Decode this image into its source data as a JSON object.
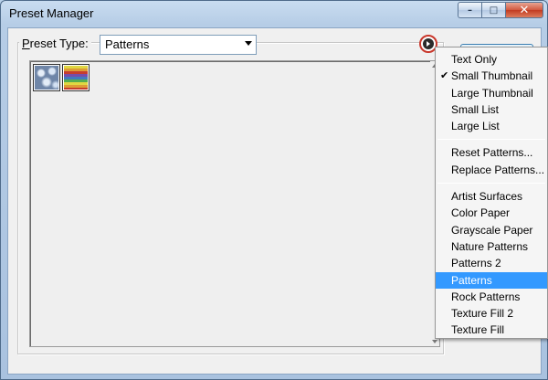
{
  "window": {
    "title": "Preset Manager",
    "controls": {
      "minimize": "–",
      "maximize": "□",
      "close": "✕"
    }
  },
  "preset_type": {
    "label_access": "P",
    "label_rest": "reset Type:",
    "value": "Patterns"
  },
  "thumbnails": [
    {
      "name": "bubbles-pattern"
    },
    {
      "name": "rainbow-pattern"
    }
  ],
  "menu": {
    "view_items": [
      {
        "label": "Text Only",
        "checked": false
      },
      {
        "label": "Small Thumbnail",
        "checked": true
      },
      {
        "label": "Large Thumbnail",
        "checked": false
      },
      {
        "label": "Small List",
        "checked": false
      },
      {
        "label": "Large List",
        "checked": false
      }
    ],
    "action_items": [
      {
        "label": "Reset Patterns..."
      },
      {
        "label": "Replace Patterns..."
      }
    ],
    "library_items": [
      {
        "label": "Artist Surfaces",
        "selected": false
      },
      {
        "label": "Color Paper",
        "selected": false
      },
      {
        "label": "Grayscale Paper",
        "selected": false
      },
      {
        "label": "Nature Patterns",
        "selected": false
      },
      {
        "label": "Patterns 2",
        "selected": false
      },
      {
        "label": "Patterns",
        "selected": true
      },
      {
        "label": "Rock Patterns",
        "selected": false
      },
      {
        "label": "Texture Fill 2",
        "selected": false
      },
      {
        "label": "Texture Fill",
        "selected": false
      }
    ]
  },
  "colors": {
    "highlight": "#3399ff",
    "callout_circle": "#c8372b"
  }
}
